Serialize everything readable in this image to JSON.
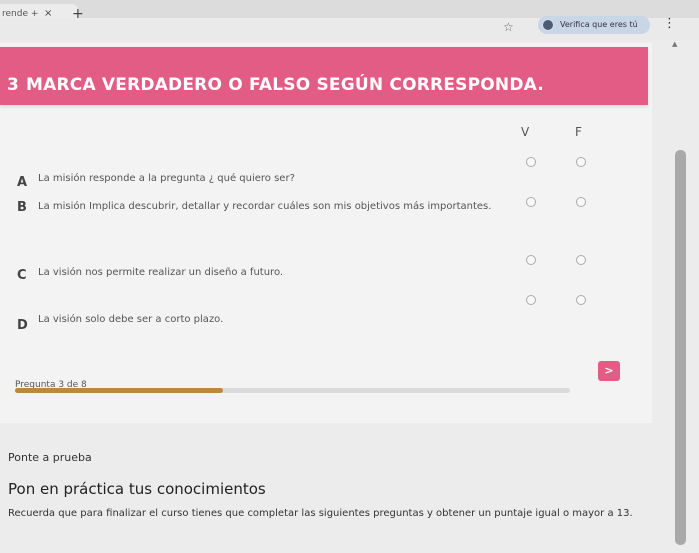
{
  "browser": {
    "tab_title": "rende +",
    "tab_close": "×",
    "tab_new": "+",
    "star": "☆",
    "profile_label": "Verifica que eres tú",
    "menu": "⋮",
    "scroll_up": "▲"
  },
  "question": {
    "number": "3",
    "title": "MARCA VERDADERO O FALSO SEGÚN CORRESPONDA.",
    "columns": [
      "V",
      "F"
    ],
    "rows": [
      {
        "letter": "A",
        "text": "La misión responde a la pregunta ¿ qué quiero ser?"
      },
      {
        "letter": "B",
        "text": "La misión Implica descubrir, detallar y recordar cuáles son mis objetivos más importantes."
      },
      {
        "letter": "C",
        "text": "La visión nos permite realizar un diseño a futuro."
      },
      {
        "letter": "D",
        "text": "La visión solo debe ser a corto plazo."
      }
    ]
  },
  "progress": {
    "label": "Pregunta 3 de 8",
    "fraction": 0.375,
    "next_label": ">"
  },
  "section": {
    "label": "Ponte a prueba",
    "title": "Pon en práctica tus conocimientos",
    "text": "Recuerda que para finalizar el curso tienes que completar las siguientes preguntas y obtener un puntaje igual o mayor a 13."
  },
  "colors": {
    "accent": "#e25c86",
    "progress": "#b88a3c"
  }
}
